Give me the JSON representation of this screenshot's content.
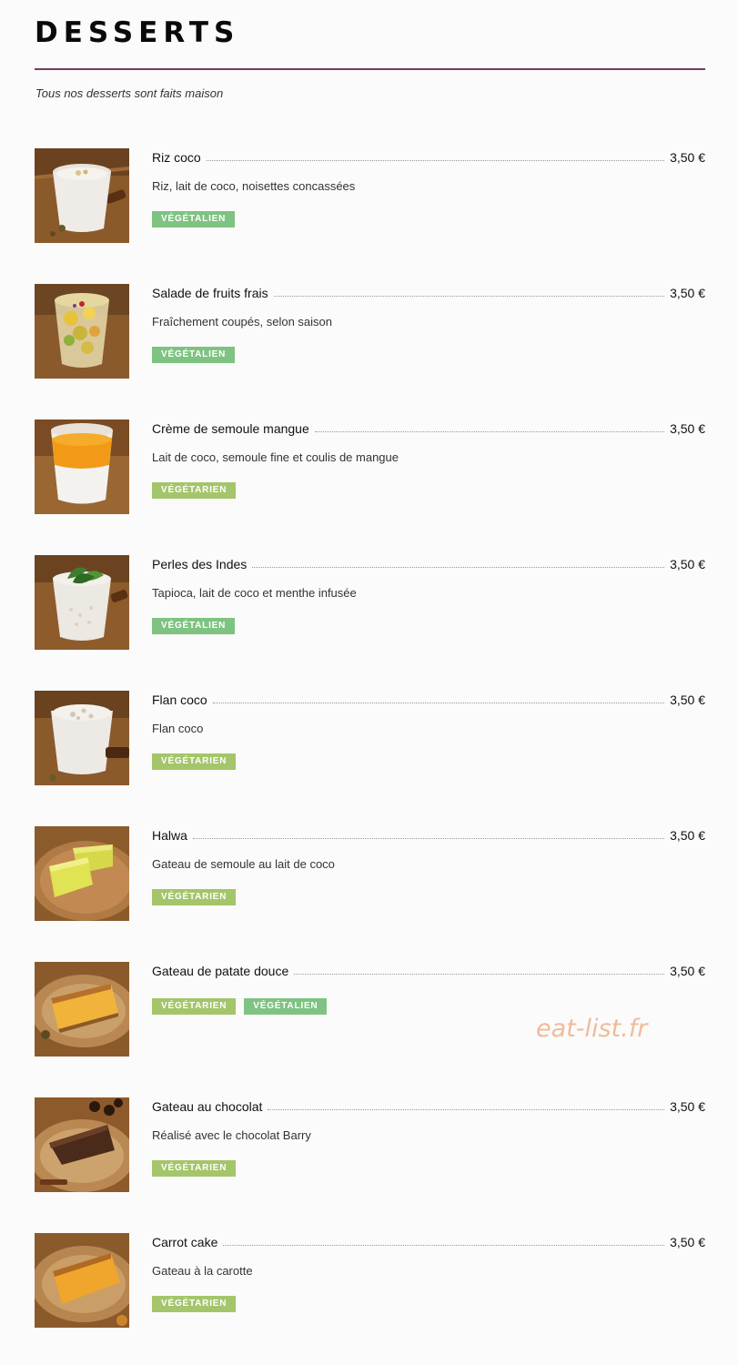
{
  "page": {
    "title": "DESSERTS",
    "intro": "Tous nos desserts sont faits maison",
    "accent_color": "#6e3f62",
    "watermark": "eat-list.fr"
  },
  "tags": {
    "vegan": {
      "label": "Végétalien",
      "color": "#7ec381"
    },
    "vegetarian": {
      "label": "Végétarien",
      "color": "#a4c56a"
    }
  },
  "items": [
    {
      "name": "Riz coco",
      "price": "3,50 €",
      "description": "Riz, lait de coco, noisettes concassées",
      "tags": [
        "Végétalien"
      ],
      "photo_icon": "rice-pudding-cup-icon"
    },
    {
      "name": "Salade de fruits frais",
      "price": "3,50 €",
      "description": "Fraîchement coupés, selon saison",
      "tags": [
        "Végétalien"
      ],
      "photo_icon": "fruit-salad-cup-icon"
    },
    {
      "name": "Crème de semoule mangue",
      "price": "3,50 €",
      "description": "Lait de coco, semoule fine et coulis de mangue",
      "tags": [
        "Végétarien"
      ],
      "photo_icon": "mango-semolina-cup-icon"
    },
    {
      "name": "Perles des Indes",
      "price": "3,50 €",
      "description": "Tapioca, lait de coco et menthe infusée",
      "tags": [
        "Végétalien"
      ],
      "photo_icon": "tapioca-mint-cup-icon"
    },
    {
      "name": "Flan coco",
      "price": "3,50 €",
      "description": "Flan coco",
      "tags": [
        "Végétarien"
      ],
      "photo_icon": "coconut-flan-cup-icon"
    },
    {
      "name": "Halwa",
      "price": "3,50 €",
      "description": "Gateau de semoule au lait de coco",
      "tags": [
        "Végétarien"
      ],
      "photo_icon": "halwa-slices-icon"
    },
    {
      "name": "Gateau de patate douce",
      "price": "3,50 €",
      "description": "",
      "tags": [
        "Végétarien",
        "Végétalien"
      ],
      "photo_icon": "sweet-potato-cake-icon"
    },
    {
      "name": "Gateau au chocolat",
      "price": "3,50 €",
      "description": "Réalisé avec le chocolat Barry",
      "tags": [
        "Végétarien"
      ],
      "photo_icon": "chocolate-cake-icon"
    },
    {
      "name": "Carrot cake",
      "price": "3,50 €",
      "description": "Gateau à la carotte",
      "tags": [
        "Végétarien"
      ],
      "photo_icon": "carrot-cake-icon"
    }
  ]
}
